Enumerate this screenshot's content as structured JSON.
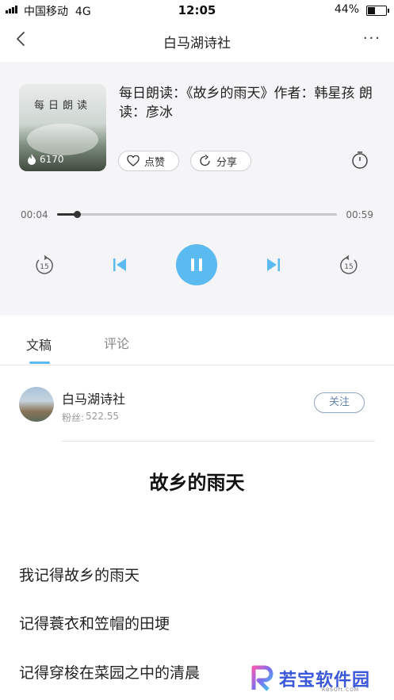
{
  "status_bar": {
    "carrier": "中国移动",
    "network": "4G",
    "time": "12:05",
    "battery": "44%",
    "battery_level": 0.44
  },
  "nav": {
    "title": "白马湖诗社",
    "back_icon": "chevron-left-icon",
    "more_icon": "more-dots-icon",
    "more_glyph": "···"
  },
  "player": {
    "cover_text": "每日朗读",
    "play_count": "6170",
    "description": "每日朗读：《故乡的雨天》作者：韩星孩 朗读：彦冰",
    "like_label": "点赞",
    "share_label": "分享",
    "time_current": "00:04",
    "time_total": "00:59",
    "progress": 0.07,
    "rewind_seconds": "15",
    "forward_seconds": "15",
    "accent": "#5bbbf0"
  },
  "tabs": [
    {
      "label": "文稿",
      "active": true
    },
    {
      "label": "评论",
      "active": false
    }
  ],
  "author": {
    "name": "白马湖诗社",
    "fans_label": "粉丝:",
    "fans_count": "522.55",
    "follow_label": "关注"
  },
  "article": {
    "title": "故乡的雨天",
    "lines": [
      "我记得故乡的雨天",
      "记得蓑衣和笠帽的田埂",
      "记得穿梭在菜园之中的清晨"
    ]
  },
  "watermark": {
    "text": "若宝软件园",
    "sub": "RBSOft.COM"
  }
}
